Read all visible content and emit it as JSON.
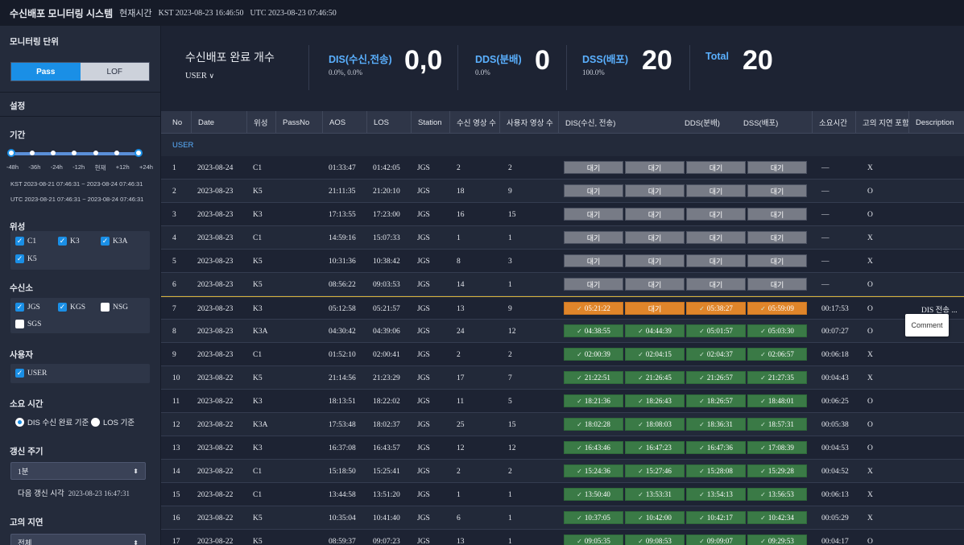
{
  "header": {
    "title": "수신배포 모니터링 시스템",
    "now_label": "현재시간",
    "kst": "KST 2023-08-23 16:46:50",
    "utc": "UTC 2023-08-23 07:46:50"
  },
  "sidebar": {
    "monitor_unit_label": "모니터링 단위",
    "unit_options": [
      "Pass",
      "LOF"
    ],
    "unit_selected": "Pass",
    "settings_label": "설정",
    "period_label": "기간",
    "period_ticks": [
      "-48h",
      "-36h",
      "-24h",
      "-12h",
      "현재",
      "+12h",
      "+24h"
    ],
    "period_kst": "KST 2023-08-21 07:46:31 ~ 2023-08-24 07:46:31",
    "period_utc": "UTC 2023-08-21 07:46:31 ~ 2023-08-24 07:46:31",
    "satellite_label": "위성",
    "satellites": [
      {
        "label": "C1",
        "checked": true
      },
      {
        "label": "K3",
        "checked": true
      },
      {
        "label": "K3A",
        "checked": true
      },
      {
        "label": "K5",
        "checked": true
      }
    ],
    "station_label": "수신소",
    "stations": [
      {
        "label": "JGS",
        "checked": true
      },
      {
        "label": "KGS",
        "checked": true
      },
      {
        "label": "NSG",
        "checked": false
      },
      {
        "label": "SGS",
        "checked": false
      }
    ],
    "user_label": "사용자",
    "users": [
      {
        "label": "USER",
        "checked": true
      }
    ],
    "duration_label": "소요 시간",
    "duration_options": [
      {
        "label": "DIS 수신 완료 기준",
        "selected": true
      },
      {
        "label": "LOS 기준",
        "selected": false
      }
    ],
    "refresh_label": "갱신 주기",
    "refresh_value": "1분",
    "next_refresh_label": "다음 갱신 시각",
    "next_refresh_time": "2023-08-23 16:47:31",
    "delay_label": "고의 지연",
    "delay_value": "전체"
  },
  "summary": {
    "complete_label": "수신배포 완료 개수",
    "user_select": "USER",
    "dis_label": "DIS(수신,전송)",
    "dis_pct": "0.0%, 0.0%",
    "dis_value": "0,0",
    "dds_label": "DDS(분배)",
    "dds_pct": "0.0%",
    "dds_value": "0",
    "dss_label": "DSS(배포)",
    "dss_pct": "100.0%",
    "dss_value": "20",
    "total_label": "Total",
    "total_value": "20"
  },
  "table": {
    "headers": [
      "No",
      "Date",
      "위성",
      "PassNo",
      "AOS",
      "LOS",
      "Station",
      "수신 영상 수",
      "사용자 영상 수",
      "DIS(수신, 전송)",
      "DDS(분배)",
      "DSS(배포)",
      "소요시간",
      "고의 지연 포함",
      "Description"
    ],
    "group": "USER",
    "rows": [
      {
        "no": "1",
        "date": "2023-08-24",
        "sat": "C1",
        "aos": "01:33:47",
        "los": "01:42:05",
        "station": "JGS",
        "recv": "2",
        "user": "2",
        "s": [
          "대기",
          "대기",
          "대기",
          "대기"
        ],
        "k": [
          "wait",
          "wait",
          "wait",
          "wait"
        ],
        "dur": "—",
        "delay": "X",
        "desc": ""
      },
      {
        "no": "2",
        "date": "2023-08-23",
        "sat": "K5",
        "aos": "21:11:35",
        "los": "21:20:10",
        "station": "JGS",
        "recv": "18",
        "user": "9",
        "s": [
          "대기",
          "대기",
          "대기",
          "대기"
        ],
        "k": [
          "wait",
          "wait",
          "wait",
          "wait"
        ],
        "dur": "—",
        "delay": "O",
        "desc": ""
      },
      {
        "no": "3",
        "date": "2023-08-23",
        "sat": "K3",
        "aos": "17:13:55",
        "los": "17:23:00",
        "station": "JGS",
        "recv": "16",
        "user": "15",
        "s": [
          "대기",
          "대기",
          "대기",
          "대기"
        ],
        "k": [
          "wait",
          "wait",
          "wait",
          "wait"
        ],
        "dur": "—",
        "delay": "O",
        "desc": ""
      },
      {
        "no": "4",
        "date": "2023-08-23",
        "sat": "C1",
        "aos": "14:59:16",
        "los": "15:07:33",
        "station": "JGS",
        "recv": "1",
        "user": "1",
        "s": [
          "대기",
          "대기",
          "대기",
          "대기"
        ],
        "k": [
          "wait",
          "wait",
          "wait",
          "wait"
        ],
        "dur": "—",
        "delay": "X",
        "desc": ""
      },
      {
        "no": "5",
        "date": "2023-08-23",
        "sat": "K5",
        "aos": "10:31:36",
        "los": "10:38:42",
        "station": "JGS",
        "recv": "8",
        "user": "3",
        "s": [
          "대기",
          "대기",
          "대기",
          "대기"
        ],
        "k": [
          "wait",
          "wait",
          "wait",
          "wait"
        ],
        "dur": "—",
        "delay": "X",
        "desc": ""
      },
      {
        "no": "6",
        "date": "2023-08-23",
        "sat": "K5",
        "aos": "08:56:22",
        "los": "09:03:53",
        "station": "JGS",
        "recv": "14",
        "user": "1",
        "s": [
          "대기",
          "대기",
          "대기",
          "대기"
        ],
        "k": [
          "wait",
          "wait",
          "wait",
          "wait"
        ],
        "dur": "—",
        "delay": "O",
        "desc": ""
      },
      {
        "no": "7",
        "date": "2023-08-23",
        "sat": "K3",
        "aos": "05:12:58",
        "los": "05:21:57",
        "station": "JGS",
        "recv": "13",
        "user": "9",
        "s": [
          "05:21:22",
          "대기",
          "05:38:27",
          "05:59:09"
        ],
        "k": [
          "warn",
          "warn",
          "warn",
          "warn"
        ],
        "dur": "00:17:53",
        "delay": "O",
        "desc": "DIS 전송 ..."
      },
      {
        "no": "8",
        "date": "2023-08-23",
        "sat": "K3A",
        "aos": "04:30:42",
        "los": "04:39:06",
        "station": "JGS",
        "recv": "24",
        "user": "12",
        "s": [
          "04:38:55",
          "04:44:39",
          "05:01:57",
          "05:03:30"
        ],
        "k": [
          "done",
          "done",
          "done",
          "done"
        ],
        "dur": "00:07:27",
        "delay": "O",
        "desc": ""
      },
      {
        "no": "9",
        "date": "2023-08-23",
        "sat": "C1",
        "aos": "01:52:10",
        "los": "02:00:41",
        "station": "JGS",
        "recv": "2",
        "user": "2",
        "s": [
          "02:00:39",
          "02:04:15",
          "02:04:37",
          "02:06:57"
        ],
        "k": [
          "done",
          "done",
          "done",
          "done"
        ],
        "dur": "00:06:18",
        "delay": "X",
        "desc": ""
      },
      {
        "no": "10",
        "date": "2023-08-22",
        "sat": "K5",
        "aos": "21:14:56",
        "los": "21:23:29",
        "station": "JGS",
        "recv": "17",
        "user": "7",
        "s": [
          "21:22:51",
          "21:26:45",
          "21:26:57",
          "21:27:35"
        ],
        "k": [
          "done",
          "done",
          "done",
          "done"
        ],
        "dur": "00:04:43",
        "delay": "X",
        "desc": ""
      },
      {
        "no": "11",
        "date": "2023-08-22",
        "sat": "K3",
        "aos": "18:13:51",
        "los": "18:22:02",
        "station": "JGS",
        "recv": "11",
        "user": "5",
        "s": [
          "18:21:36",
          "18:26:43",
          "18:26:57",
          "18:48:01"
        ],
        "k": [
          "done",
          "done",
          "done",
          "done"
        ],
        "dur": "00:06:25",
        "delay": "O",
        "desc": ""
      },
      {
        "no": "12",
        "date": "2023-08-22",
        "sat": "K3A",
        "aos": "17:53:48",
        "los": "18:02:37",
        "station": "JGS",
        "recv": "25",
        "user": "15",
        "s": [
          "18:02:28",
          "18:08:03",
          "18:36:31",
          "18:57:31"
        ],
        "k": [
          "done",
          "done",
          "done",
          "done"
        ],
        "dur": "00:05:38",
        "delay": "O",
        "desc": ""
      },
      {
        "no": "13",
        "date": "2023-08-22",
        "sat": "K3",
        "aos": "16:37:08",
        "los": "16:43:57",
        "station": "JGS",
        "recv": "12",
        "user": "12",
        "s": [
          "16:43:46",
          "16:47:23",
          "16:47:36",
          "17:08:39"
        ],
        "k": [
          "done",
          "done",
          "done",
          "done"
        ],
        "dur": "00:04:53",
        "delay": "O",
        "desc": ""
      },
      {
        "no": "14",
        "date": "2023-08-22",
        "sat": "C1",
        "aos": "15:18:50",
        "los": "15:25:41",
        "station": "JGS",
        "recv": "2",
        "user": "2",
        "s": [
          "15:24:36",
          "15:27:46",
          "15:28:08",
          "15:29:28"
        ],
        "k": [
          "done",
          "done",
          "done",
          "done"
        ],
        "dur": "00:04:52",
        "delay": "X",
        "desc": ""
      },
      {
        "no": "15",
        "date": "2023-08-22",
        "sat": "C1",
        "aos": "13:44:58",
        "los": "13:51:20",
        "station": "JGS",
        "recv": "1",
        "user": "1",
        "s": [
          "13:50:40",
          "13:53:31",
          "13:54:13",
          "13:56:53"
        ],
        "k": [
          "done",
          "done",
          "done",
          "done"
        ],
        "dur": "00:06:13",
        "delay": "X",
        "desc": ""
      },
      {
        "no": "16",
        "date": "2023-08-22",
        "sat": "K5",
        "aos": "10:35:04",
        "los": "10:41:40",
        "station": "JGS",
        "recv": "6",
        "user": "1",
        "s": [
          "10:37:05",
          "10:42:00",
          "10:42:17",
          "10:42:34"
        ],
        "k": [
          "done",
          "done",
          "done",
          "done"
        ],
        "dur": "00:05:29",
        "delay": "X",
        "desc": ""
      },
      {
        "no": "17",
        "date": "2023-08-22",
        "sat": "K5",
        "aos": "08:59:37",
        "los": "09:07:23",
        "station": "JGS",
        "recv": "13",
        "user": "1",
        "s": [
          "09:05:35",
          "09:08:53",
          "09:09:07",
          "09:29:53"
        ],
        "k": [
          "done",
          "done",
          "done",
          "done"
        ],
        "dur": "00:04:17",
        "delay": "O",
        "desc": ""
      }
    ],
    "tooltip": "Comment"
  },
  "colors": {
    "accent": "#1a8fe6",
    "done": "#3a7a46",
    "warn": "#e0852a",
    "wait": "#777b86",
    "highlight": "#d8b33a"
  }
}
